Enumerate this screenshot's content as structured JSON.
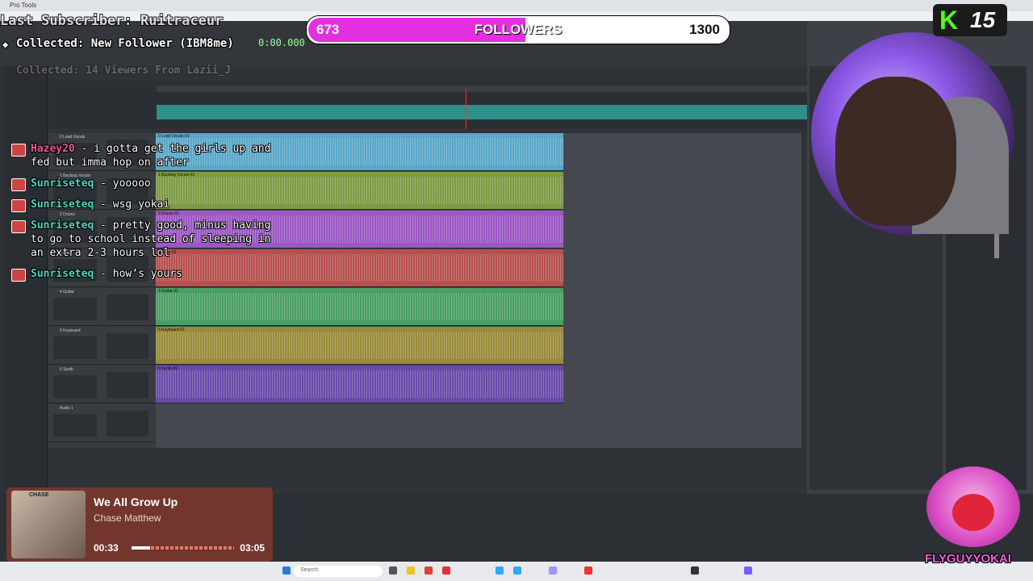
{
  "daw": {
    "window_title": "Pro Tools",
    "counter": "0:00.000",
    "tracks": [
      {
        "name": "0 Lead Vocals",
        "clip": "0 Lead Vocals-01",
        "color": "#5aa7c8"
      },
      {
        "name": "1 Backing Vocals",
        "clip": "1 Backing Vocals-01",
        "color": "#7e9a45"
      },
      {
        "name": "2 Drums",
        "clip": "2 Drums-01",
        "color": "#9b57c4"
      },
      {
        "name": "3 Bass",
        "clip": "3 Bass-01",
        "color": "#b5504e"
      },
      {
        "name": "4 Guitar",
        "clip": "4 Guitar-01",
        "color": "#4a9e63"
      },
      {
        "name": "5 Keyboard",
        "clip": "5 Keyboard-01",
        "color": "#9a8b3a"
      },
      {
        "name": "6 Synth",
        "clip": "6 Synth-01",
        "color": "#6a4aa8"
      },
      {
        "name": "Audio 1",
        "clip": "",
        "color": "#3a3f45"
      }
    ],
    "search_placeholder": "Search"
  },
  "overlay": {
    "last_subscriber": "Last Subscriber: Ruitraceur",
    "collected_follower": "Collected: New Follower (IBM8me)",
    "collected_viewers": "Collected: 14 Viewers From Lazii_J",
    "goal": {
      "current": "673",
      "label": "FOLLOWERS",
      "target": "1300",
      "fraction": 0.517,
      "color": "#e22fe0"
    },
    "kick_viewers": "15",
    "channel_name": "FLYGUYYOKAI"
  },
  "chat": [
    {
      "user": "Hazey20",
      "user_color": "#e85a9a",
      "sep": " - ",
      "text": "i gotta get the girls up and fed but imma hop on after"
    },
    {
      "user": "Sunriseteq",
      "user_color": "#4ad9c0",
      "sep": " - ",
      "text": "yooooo"
    },
    {
      "user": "Sunriseteq",
      "user_color": "#4ad9c0",
      "sep": " - ",
      "text": "wsg yokai"
    },
    {
      "user": "Sunriseteq",
      "user_color": "#4ad9c0",
      "sep": " - ",
      "text": "pretty good, minus having to go to school instead of sleeping in an extra 2-3 hours lol"
    },
    {
      "user": "Sunriseteq",
      "user_color": "#4ad9c0",
      "sep": " - ",
      "text": "how’s yours"
    }
  ],
  "now_playing": {
    "album_tag": "CHASE",
    "title": "We All Grow Up",
    "artist": "Chase Matthew",
    "current_time": "00:33",
    "total_time": "03:05",
    "progress": 0.18
  }
}
